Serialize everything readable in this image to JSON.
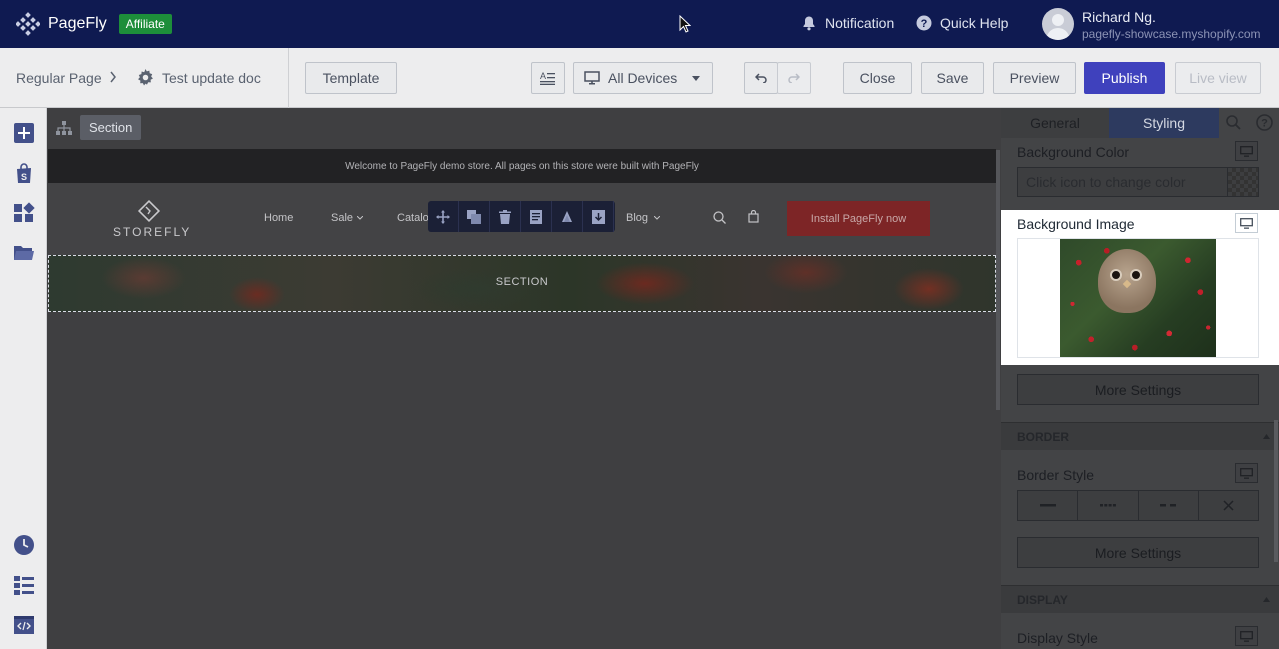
{
  "topbar": {
    "brand": "PageFly",
    "badge": "Affiliate",
    "notification": "Notification",
    "quick_help": "Quick Help",
    "user_name": "Richard Ng.",
    "user_shop": "pagefly-showcase.myshopify.com"
  },
  "toolbar": {
    "breadcrumb_root": "Regular Page",
    "page_name": "Test update doc",
    "template": "Template",
    "device": "All Devices",
    "close": "Close",
    "save": "Save",
    "preview": "Preview",
    "publish": "Publish",
    "live_view": "Live view"
  },
  "canvas": {
    "selected_tag": "Section",
    "announcement": "Welcome to PageFly demo store. All pages on this store were built with PageFly",
    "store_logo": "STOREFLY",
    "nav": [
      "Home",
      "Sale",
      "Catalog",
      "Blog"
    ],
    "install_button": "Install PageFly now",
    "section_label": "SECTION"
  },
  "panel": {
    "tabs": [
      "General",
      "Styling"
    ],
    "active_tab": "Styling",
    "background_color_label": "Background Color",
    "color_placeholder": "Click icon to change color",
    "background_image_label": "Background Image",
    "more_settings_1": "More Settings",
    "border_header": "BORDER",
    "border_style_label": "Border Style",
    "more_settings_2": "More Settings",
    "display_header": "DISPLAY",
    "display_style_label": "Display Style"
  },
  "colors": {
    "topbar": "#0f1a51",
    "affiliate": "#1d8e3a",
    "publish": "#3f41bd",
    "install": "#c03a3c"
  }
}
